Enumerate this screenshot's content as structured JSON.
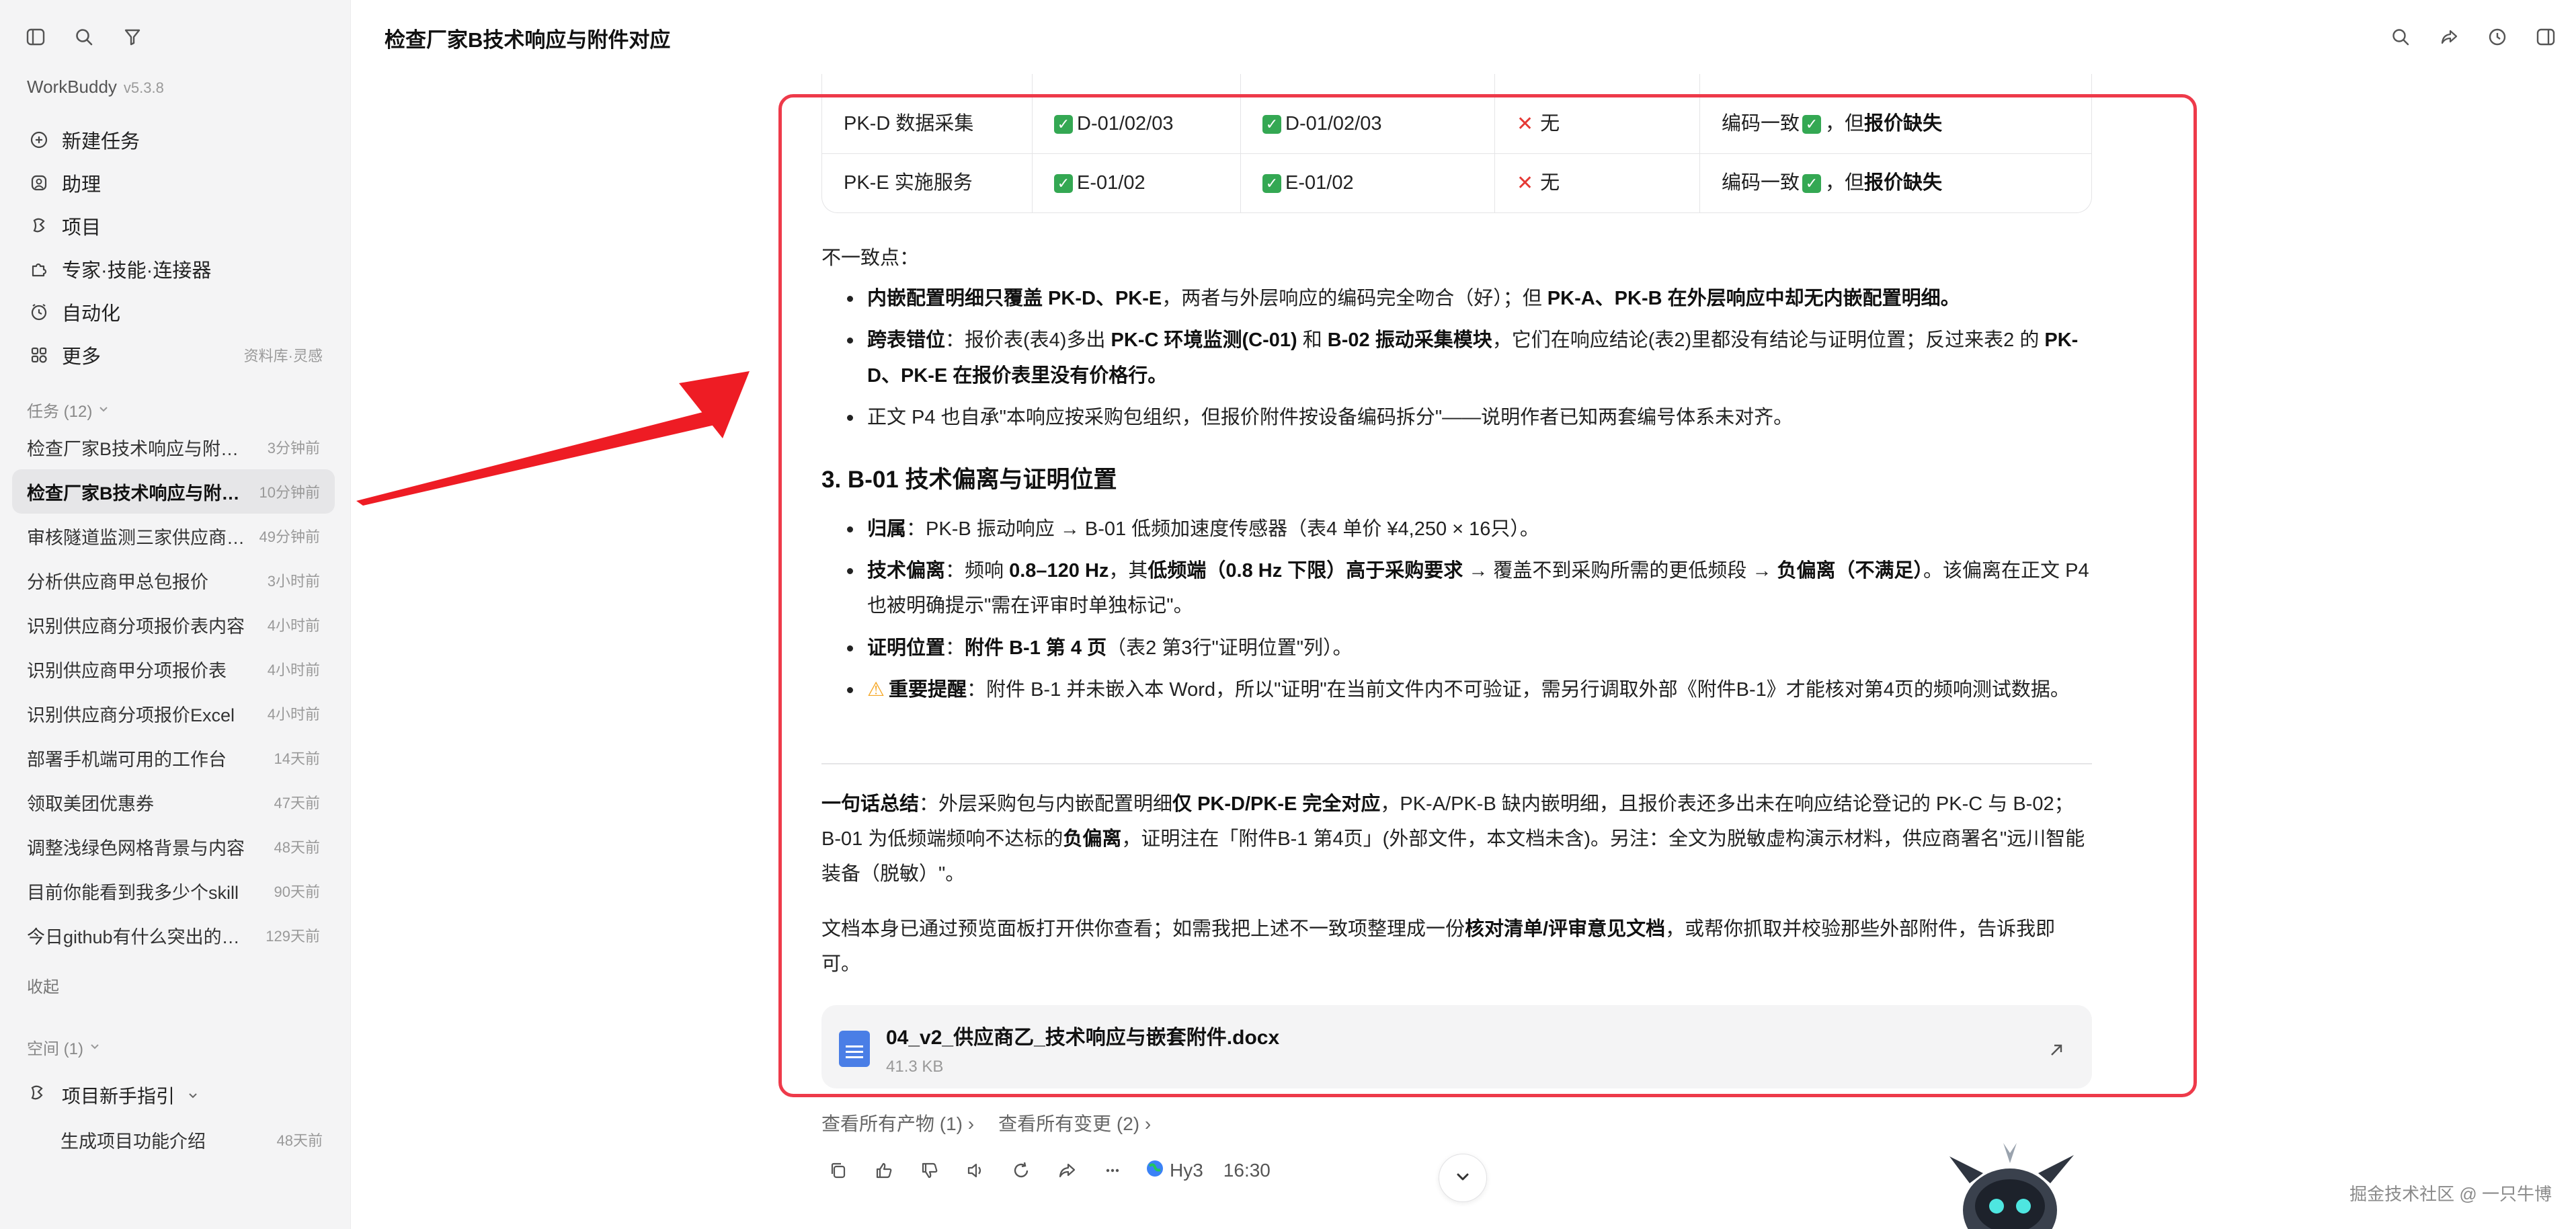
{
  "sidebar": {
    "app_name": "WorkBuddy",
    "version": "v5.3.8",
    "nav": [
      {
        "label": "新建任务"
      },
      {
        "label": "助理"
      },
      {
        "label": "项目"
      },
      {
        "label": "专家·技能·连接器"
      },
      {
        "label": "自动化"
      },
      {
        "label": "更多",
        "extra": "资料库·灵感"
      }
    ],
    "tasks_header": "任务 (12)",
    "tasks": [
      {
        "title": "检查厂家B技术响应与附件对应",
        "time": "3分钟前"
      },
      {
        "title": "检查厂家B技术响应与附件对应",
        "time": "10分钟前"
      },
      {
        "title": "审核隧道监测三家供应商报价",
        "time": "49分钟前"
      },
      {
        "title": "分析供应商甲总包报价",
        "time": "3小时前"
      },
      {
        "title": "识别供应商分项报价表内容",
        "time": "4小时前"
      },
      {
        "title": "识别供应商甲分项报价表",
        "time": "4小时前"
      },
      {
        "title": "识别供应商分项报价Excel",
        "time": "4小时前"
      },
      {
        "title": "部署手机端可用的工作台",
        "time": "14天前"
      },
      {
        "title": "领取美团优惠券",
        "time": "47天前"
      },
      {
        "title": "调整浅绿色网格背景与内容",
        "time": "48天前"
      },
      {
        "title": "目前你能看到我多少个skill",
        "time": "90天前"
      },
      {
        "title": "今日github有什么突出的项目",
        "time": "129天前"
      }
    ],
    "collapse": "收起",
    "spaces_header": "空间 (1)",
    "project": "项目新手指引",
    "project_sub": {
      "title": "生成项目功能介绍",
      "time": "48天前"
    }
  },
  "header": {
    "title": "检查厂家B技术响应与附件对应"
  },
  "table": {
    "rows": [
      {
        "pkg": "PK-D 数据采集",
        "inner": "D-01/02/03",
        "outer": "D-01/02/03",
        "price": "无",
        "conclusion_a": "编码一致",
        "conclusion_b": "，但",
        "conclusion_c": "报价缺失"
      },
      {
        "pkg": "PK-E 实施服务",
        "inner": "E-01/02",
        "outer": "E-01/02",
        "price": "无",
        "conclusion_a": "编码一致",
        "conclusion_b": "，但",
        "conclusion_c": "报价缺失"
      }
    ]
  },
  "inconsistency": {
    "label": "不一致点：",
    "b1_bold": "内嵌配置明细只覆盖 PK-D、PK-E",
    "b1_text": "，两者与外层响应的编码完全吻合（好）；但 ",
    "b1_bold2": "PK-A、PK-B 在外层响应中却无内嵌配置明细。",
    "b2_bold": "跨表错位",
    "b2_text1": "：报价表(表4)多出 ",
    "b2_bold2": "PK-C 环境监测(C-01)",
    "b2_text2": " 和 ",
    "b2_bold3": "B-02 振动采集模块",
    "b2_text3": "，它们在响应结论(表2)里都没有结论与证明位置；反过来表2 的 ",
    "b2_bold4": "PK-D、PK-E 在报价表里没有价格行。",
    "b3_text": "正文 P4 也自承\"本响应按采购包组织，但报价附件按设备编码拆分\"——说明作者已知两套编号体系未对齐。"
  },
  "section3": {
    "heading": "3. B-01 技术偏离与证明位置",
    "b1_bold": "归属",
    "b1_text": "：PK-B 振动响应 → B-01 低频加速度传感器（表4 单价 ¥4,250 × 16只）。",
    "b2_bold": "技术偏离",
    "b2_text1": "：频响 ",
    "b2_bold2": "0.8–120 Hz",
    "b2_text2": "，其",
    "b2_bold3": "低频端（0.8 Hz 下限）高于采购要求",
    "b2_text3": " → 覆盖不到采购所需的更低频段 → ",
    "b2_bold4": "负偏离（不满足）",
    "b2_text4": "。该偏离在正文 P4 也被明确提示\"需在评审时单独标记\"。",
    "b3_bold": "证明位置",
    "b3_text1": "：",
    "b3_bold2": "附件 B-1 第 4 页",
    "b3_text2": "（表2 第3行\"证明位置\"列）。",
    "b4_bold": "重要提醒",
    "b4_text": "：附件 B-1 并未嵌入本 Word，所以\"证明\"在当前文件内不可验证，需另行调取外部《附件B-1》才能核对第4页的频响测试数据。"
  },
  "summary": {
    "bold1": "一句话总结",
    "t1": "：外层采购包与内嵌配置明细",
    "bold2": "仅 PK-D/PK-E 完全对应",
    "t2": "，PK-A/PK-B 缺内嵌明细，且报价表还多出未在响应结论登记的 PK-C 与 B-02；B-01 为低频端频响不达标的",
    "bold3": "负偏离",
    "t3": "，证明注在「附件B-1 第4页」(外部文件，本文档未含)。另注：全文为脱敏虚构演示材料，供应商署名\"远川智能装备（脱敏）\"。"
  },
  "closing": {
    "t1": "文档本身已通过预览面板打开供你查看；如需我把上述不一致项整理成一份",
    "bold": "核对清单/评审意见文档",
    "t2": "，或帮你抓取并校验那些外部附件，告诉我即可。"
  },
  "file": {
    "name": "04_v2_供应商乙_技术响应与嵌套附件.docx",
    "size": "41.3 KB"
  },
  "links": {
    "artifacts": "查看所有产物 (1) ›",
    "changes": "查看所有变更 (2) ›"
  },
  "actions": {
    "model": "Hy3",
    "time": "16:30"
  },
  "watermark": "掘金技术社区 @ 一只牛博",
  "colors": {
    "highlight": "#ee3a4a",
    "arrow": "#ee1c24",
    "check": "#34a853",
    "cross": "#e53935"
  }
}
